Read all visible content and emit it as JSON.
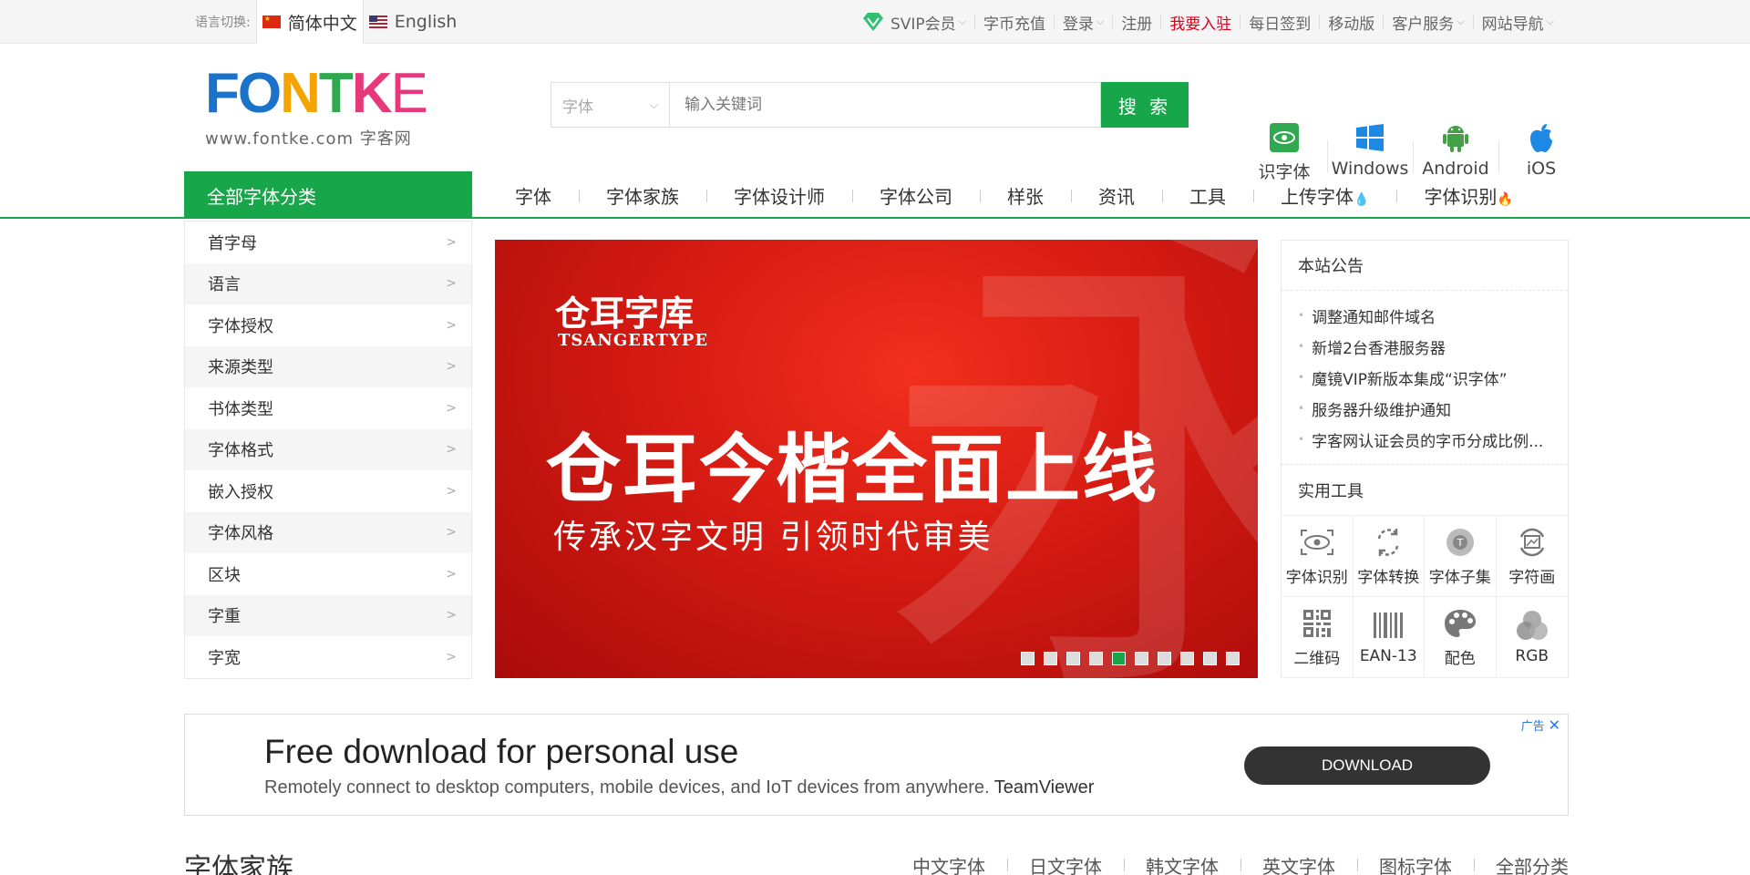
{
  "topbar": {
    "lang_label": "语言切换:",
    "lang_zh": "简体中文",
    "lang_en": "English",
    "nav": {
      "svip": "SVIP会员",
      "recharge": "字币充值",
      "login": "登录",
      "register": "注册",
      "join": "我要入驻",
      "checkin": "每日签到",
      "mobile": "移动版",
      "service": "客户服务",
      "sitenav": "网站导航"
    },
    "colors": {
      "join": "#e0001b",
      "vip_icon": "#2fbf71"
    }
  },
  "header": {
    "logo_text": "FONTKE",
    "logo_sub": "www.fontke.com 字客网",
    "search": {
      "select_value": "字体",
      "placeholder": "输入关键词",
      "button": "搜 索"
    },
    "apps": [
      {
        "label": "识字体",
        "icon": "eye-scan-icon"
      },
      {
        "label": "Windows",
        "icon": "windows-icon"
      },
      {
        "label": "Android",
        "icon": "android-icon"
      },
      {
        "label": "iOS",
        "icon": "apple-icon"
      }
    ]
  },
  "mainnav": {
    "all_categories": "全部字体分类",
    "links": [
      "字体",
      "字体家族",
      "字体设计师",
      "字体公司",
      "样张",
      "资讯",
      "工具",
      "上传字体",
      "字体识别"
    ],
    "accent": "#17a64a"
  },
  "sidebar": {
    "items": [
      "首字母",
      "语言",
      "字体授权",
      "来源类型",
      "书体类型",
      "字体格式",
      "嵌入授权",
      "字体风格",
      "区块",
      "字重",
      "字宽"
    ]
  },
  "banner": {
    "brand": "仓耳字库",
    "brand_en": "TSANGERTYPE",
    "title": "仓耳今楷全面上线",
    "subtitle": "传承汉字文明 引领时代审美",
    "slide_count": 10,
    "active_slide": 5
  },
  "rightbox": {
    "notice_title": "本站公告",
    "notices": [
      "调整通知邮件域名",
      "新增2台香港服务器",
      "魔镜VIP新版本集成“识字体”",
      "服务器升级维护通知",
      "字客网认证会员的字币分成比例..."
    ],
    "tools_title": "实用工具",
    "tools": [
      {
        "label": "字体识别",
        "icon": "eye-scan-icon"
      },
      {
        "label": "字体转换",
        "icon": "convert-icon"
      },
      {
        "label": "字体子集",
        "icon": "subset-icon"
      },
      {
        "label": "字符画",
        "icon": "ascii-art-icon"
      },
      {
        "label": "二维码",
        "icon": "qrcode-icon"
      },
      {
        "label": "EAN-13",
        "icon": "barcode-icon"
      },
      {
        "label": "配色",
        "icon": "palette-icon"
      },
      {
        "label": "RGB",
        "icon": "rgb-icon"
      }
    ]
  },
  "ad": {
    "title": "Free download for personal use",
    "text": "Remotely connect to desktop computers, mobile devices, and IoT devices from anywhere.",
    "brand": "TeamViewer",
    "button": "DOWNLOAD",
    "label": "广告"
  },
  "family": {
    "title": "字体家族",
    "links": [
      "中文字体",
      "日文字体",
      "韩文字体",
      "英文字体",
      "图标字体",
      "全部分类"
    ]
  }
}
